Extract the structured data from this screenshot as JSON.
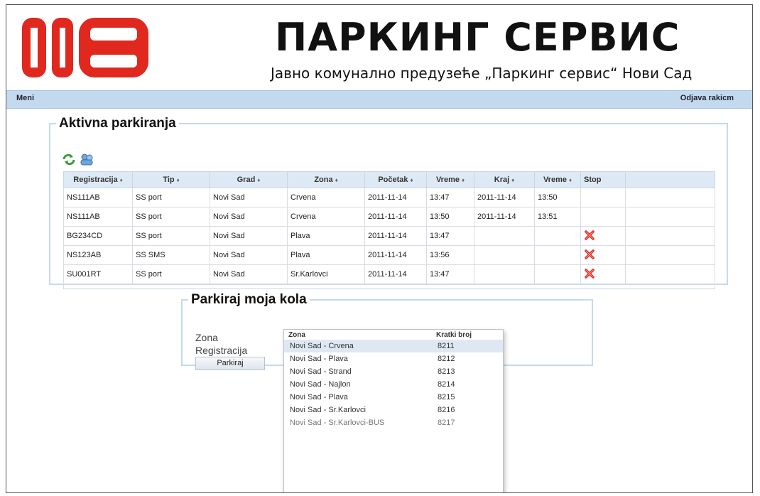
{
  "header": {
    "title": "ПАРКИНГ СЕРВИС",
    "subtitle": "Јавно комунално предузеће „Паркинг сервис“ Нови Сад",
    "logo_color": "#e0281e"
  },
  "menubar": {
    "menu": "Meni",
    "logout": "Odjava rakicm"
  },
  "active": {
    "legend": "Aktivna parkiranja",
    "columns": [
      "Registracija",
      "Tip",
      "Grad",
      "Zona",
      "Početak",
      "Vreme",
      "Kraj",
      "Vreme",
      "Stop"
    ],
    "sort_glyph": "♦",
    "rows": [
      [
        "NS111AB",
        "SS port",
        "Novi Sad",
        "Crvena",
        "2011-11-14",
        "13:47",
        "2011-11-14",
        "13:50",
        ""
      ],
      [
        "NS111AB",
        "SS port",
        "Novi Sad",
        "Crvena",
        "2011-11-14",
        "13:50",
        "2011-11-14",
        "13:51",
        ""
      ],
      [
        "BG234CD",
        "SS port",
        "Novi Sad",
        "Plava",
        "2011-11-14",
        "13:47",
        "",
        "",
        "stop-icon"
      ],
      [
        "NS123AB",
        "SS SMS",
        "Novi Sad",
        "Plava",
        "2011-11-14",
        "13:56",
        "",
        "",
        "stop-icon"
      ],
      [
        "SU001RT",
        "SS port",
        "Novi Sad",
        "Sr.Karlovci",
        "2011-11-14",
        "13:47",
        "",
        "",
        "stop-icon"
      ]
    ]
  },
  "park": {
    "legend": "Parkiraj moja kola",
    "zona_label": "Zona",
    "zona_value": "",
    "reg_label": "Registracija",
    "button": "Parkiraj"
  },
  "dropdown": {
    "col1": "Zona",
    "col2": "Kratki broj",
    "items": [
      {
        "zona": "Novi Sad - Crvena",
        "broj": "8211"
      },
      {
        "zona": "Novi Sad - Plava",
        "broj": "8212"
      },
      {
        "zona": "Novi Sad - Strand",
        "broj": "8213"
      },
      {
        "zona": "Novi Sad - Najlon",
        "broj": "8214"
      },
      {
        "zona": "Novi Sad - Plava",
        "broj": "8215"
      },
      {
        "zona": "Novi Sad - Sr.Karlovci",
        "broj": "8216"
      },
      {
        "zona": "Novi Sad - Sr.Karlovci-BUS",
        "broj": "8217"
      }
    ]
  }
}
